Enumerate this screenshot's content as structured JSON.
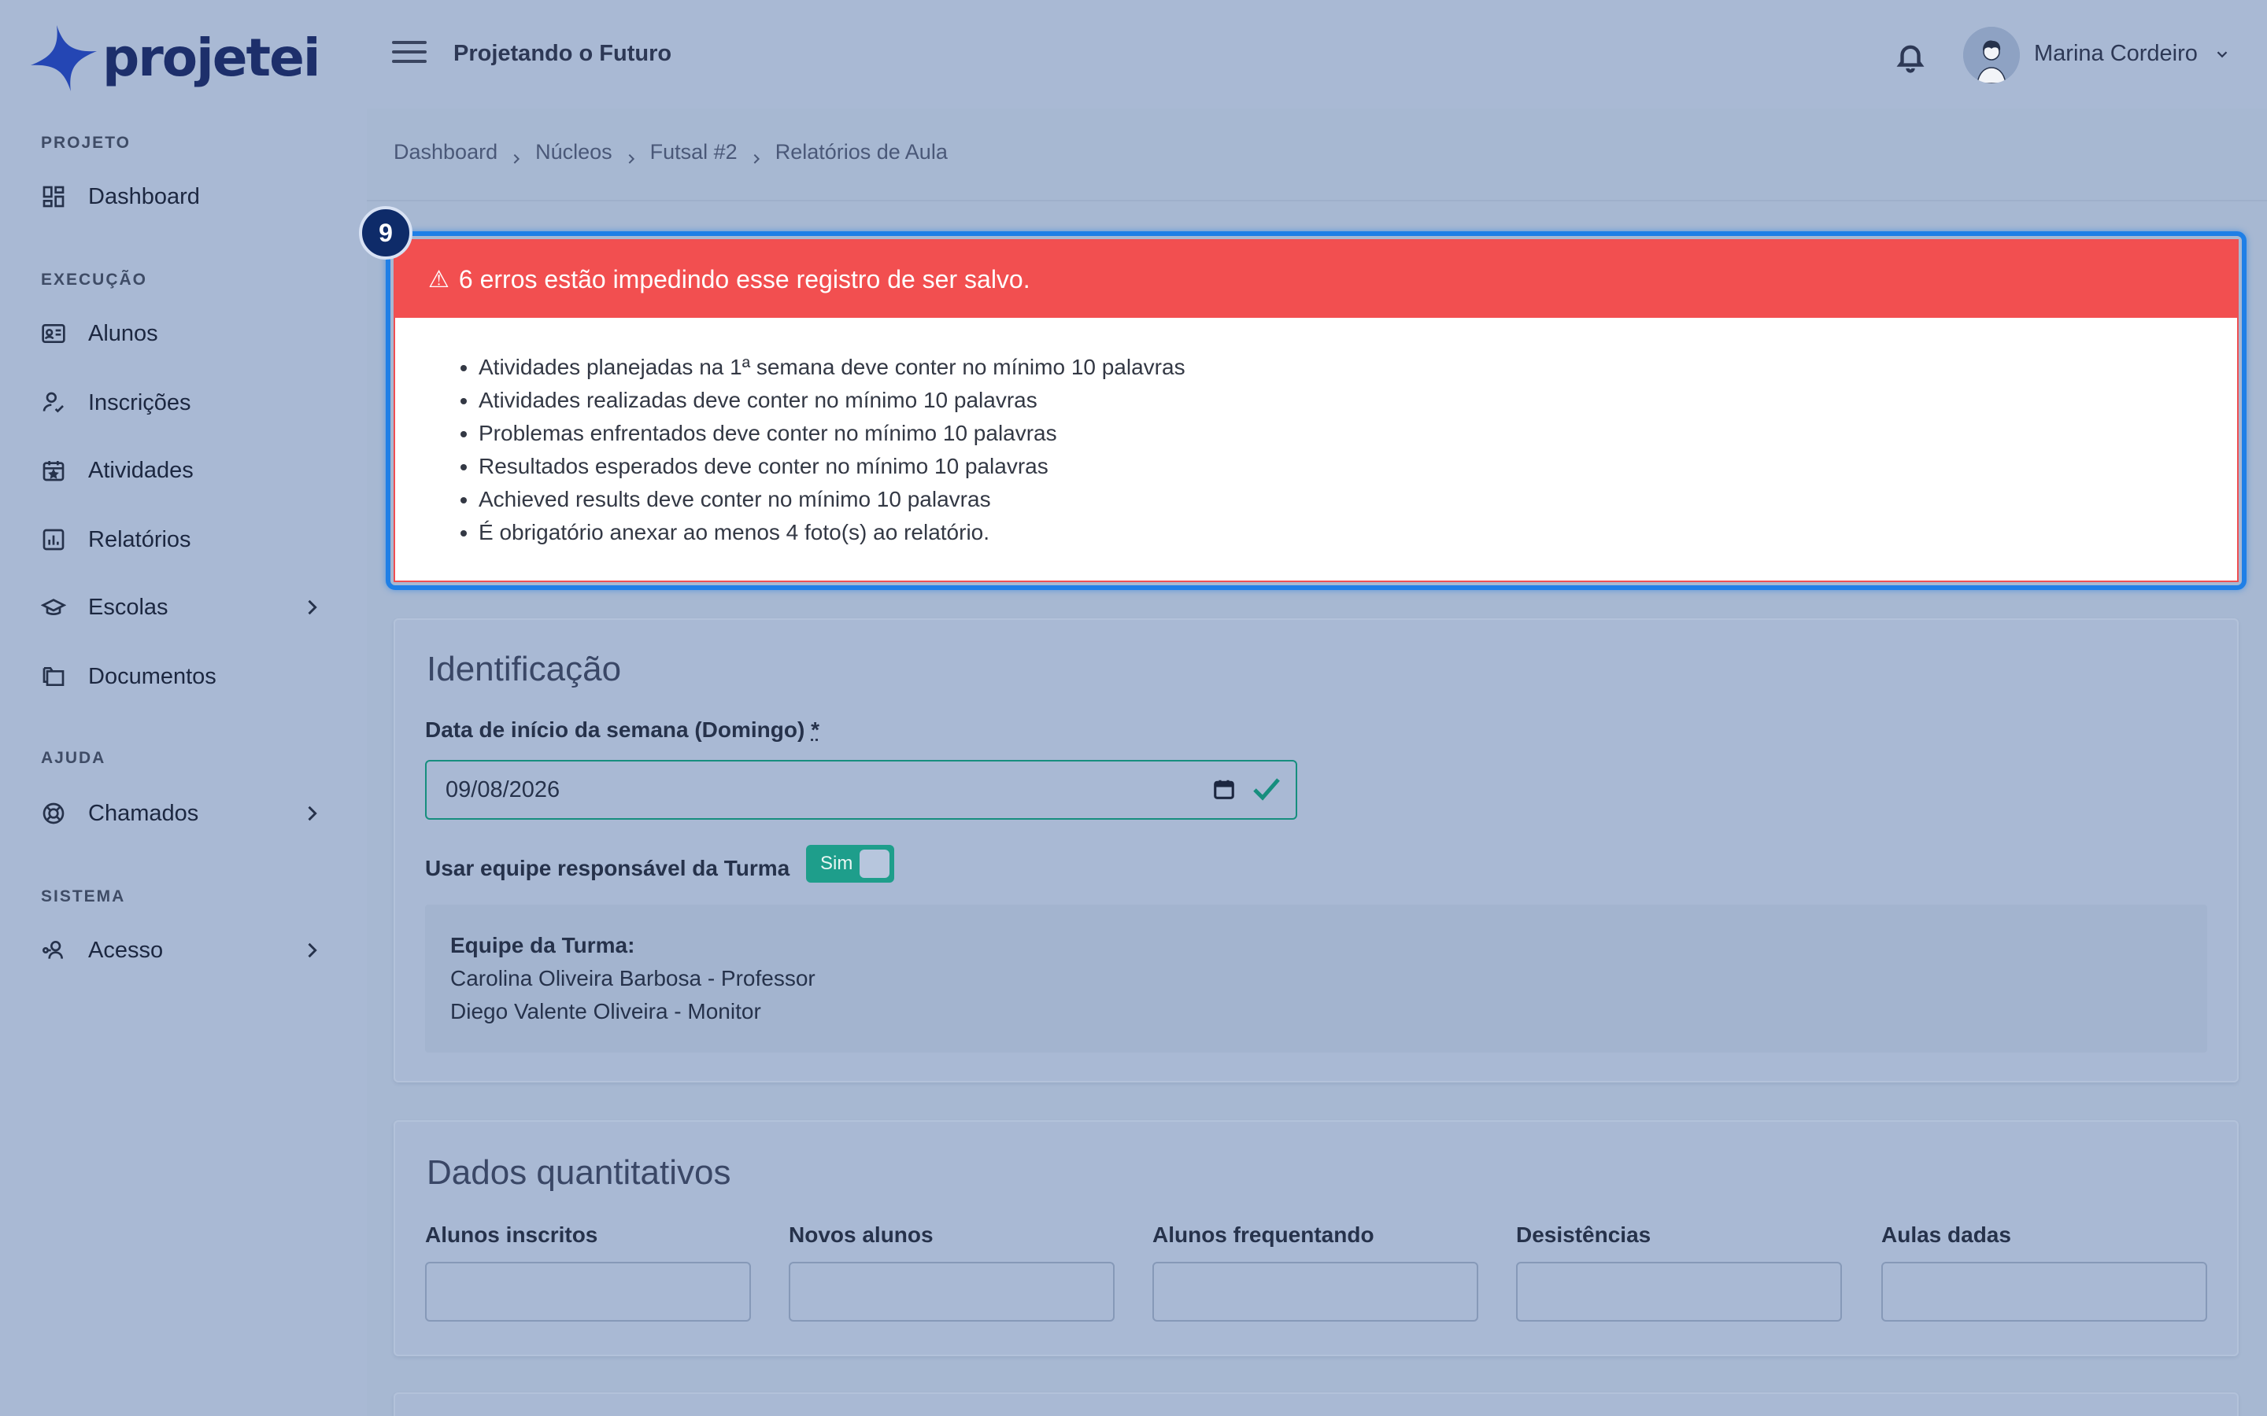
{
  "brand": {
    "name": "projetei",
    "accent": "#1d2f6b"
  },
  "sidebar": {
    "sections": [
      {
        "title": "PROJETO"
      },
      {
        "title": "EXECUÇÃO"
      },
      {
        "title": "AJUDA"
      },
      {
        "title": "SISTEMA"
      }
    ],
    "items": [
      {
        "label": "Dashboard",
        "icon": "dashboard-icon"
      },
      {
        "label": "Alunos",
        "icon": "id-card-icon"
      },
      {
        "label": "Inscrições",
        "icon": "user-check-icon"
      },
      {
        "label": "Atividades",
        "icon": "calendar-star-icon"
      },
      {
        "label": "Relatórios",
        "icon": "bar-chart-icon"
      },
      {
        "label": "Escolas",
        "icon": "graduation-cap-icon"
      },
      {
        "label": "Documentos",
        "icon": "folders-icon"
      },
      {
        "label": "Chamados",
        "icon": "lifebuoy-icon"
      },
      {
        "label": "Acesso",
        "icon": "user-key-icon"
      }
    ]
  },
  "header": {
    "project_name": "Projetando o Futuro",
    "user_name": "Marina Cordeiro"
  },
  "breadcrumb": [
    "Dashboard",
    "Núcleos",
    "Futsal #2",
    "Relatórios de Aula"
  ],
  "errors": {
    "badge": "9",
    "title": "6 erros estão impedindo esse registro de ser salvo.",
    "items": [
      "Atividades planejadas na 1ª semana deve conter no mínimo 10 palavras",
      "Atividades realizadas deve conter no mínimo 10 palavras",
      "Problemas enfrentados deve conter no mínimo 10 palavras",
      "Resultados esperados deve conter no mínimo 10 palavras",
      "Achieved results deve conter no mínimo 10 palavras",
      "É obrigatório anexar ao menos 4 foto(s) ao relatório."
    ],
    "color": "#f24f50"
  },
  "identificacao": {
    "title": "Identificação",
    "date_label": "Data de início da semana (Domingo)",
    "required_mark": "*",
    "date_value": "09/08/2026",
    "toggle_label": "Usar equipe responsável da Turma",
    "toggle_text": "Sim",
    "team_title": "Equipe da Turma:",
    "team_members": [
      "Carolina Oliveira Barbosa - Professor",
      "Diego Valente Oliveira - Monitor"
    ]
  },
  "quantitativos": {
    "title": "Dados quantitativos",
    "fields": [
      {
        "label": "Alunos inscritos",
        "value": ""
      },
      {
        "label": "Novos alunos",
        "value": ""
      },
      {
        "label": "Alunos frequentando",
        "value": ""
      },
      {
        "label": "Desistências",
        "value": ""
      },
      {
        "label": "Aulas dadas",
        "value": ""
      }
    ]
  }
}
